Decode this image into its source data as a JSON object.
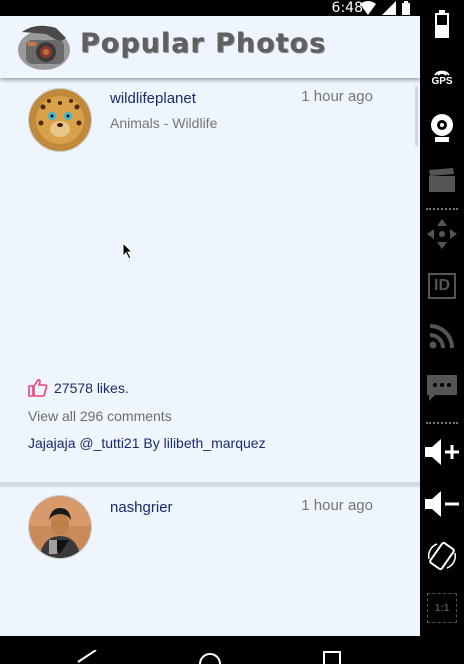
{
  "status_bar": {
    "time": "6:48"
  },
  "app": {
    "title": "Popular Photos"
  },
  "posts": [
    {
      "username": "wildlifeplanet",
      "time": "1 hour ago",
      "category": "Animals - Wildlife",
      "likes": "27578 likes.",
      "comments_link": "View all 296 comments",
      "caption": "Jajajaja @_tutti21 By lilibeth_marquez"
    },
    {
      "username": "nashgrier",
      "time": "1 hour ago"
    }
  ],
  "emulator_sidebar": {
    "gps_label": "GPS",
    "id_label": "ID",
    "scale_label": "1:1"
  },
  "colors": {
    "app_background": "#eef5fd",
    "username": "#1c2a6b",
    "like_icon": "#e8457a"
  }
}
